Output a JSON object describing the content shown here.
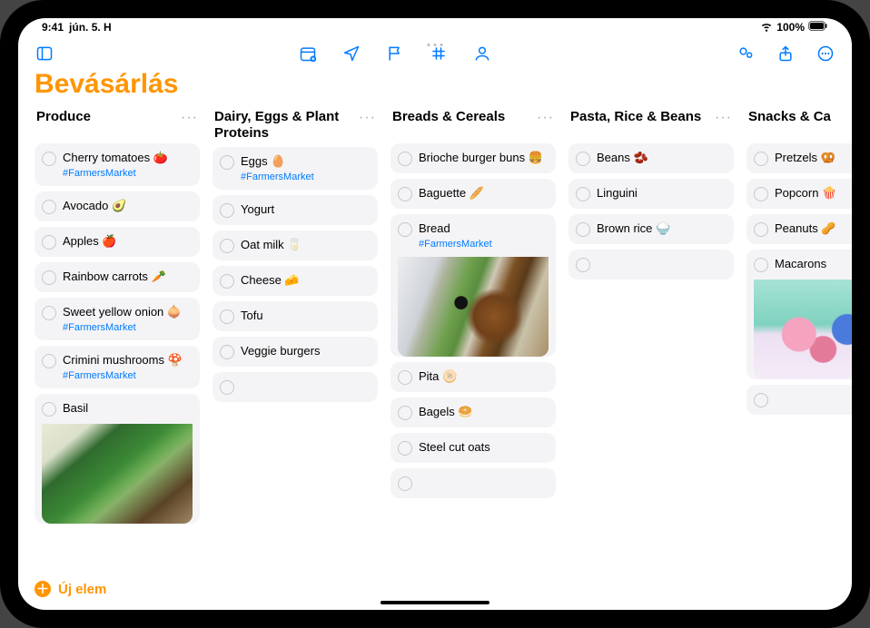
{
  "status": {
    "time": "9:41",
    "date": "jún. 5. H",
    "battery": "100%"
  },
  "list": {
    "title": "Bevásárlás",
    "newItemLabel": "Új elem"
  },
  "columns": [
    {
      "title": "Produce",
      "items": [
        {
          "text": "Cherry tomatoes 🍅",
          "tag": "#FarmersMarket"
        },
        {
          "text": "Avocado 🥑"
        },
        {
          "text": "Apples 🍎"
        },
        {
          "text": "Rainbow carrots 🥕"
        },
        {
          "text": "Sweet yellow onion 🧅",
          "tag": "#FarmersMarket"
        },
        {
          "text": "Crimini mushrooms 🍄",
          "tag": "#FarmersMarket"
        },
        {
          "text": "Basil",
          "image": "basil"
        }
      ]
    },
    {
      "title": "Dairy, Eggs & Plant Proteins",
      "items": [
        {
          "text": "Eggs 🥚",
          "tag": "#FarmersMarket"
        },
        {
          "text": "Yogurt"
        },
        {
          "text": "Oat milk 🥛"
        },
        {
          "text": "Cheese 🧀"
        },
        {
          "text": "Tofu"
        },
        {
          "text": "Veggie burgers"
        },
        {
          "empty": true
        }
      ]
    },
    {
      "title": "Breads & Cereals",
      "items": [
        {
          "text": "Brioche burger buns 🍔"
        },
        {
          "text": "Baguette 🥖"
        },
        {
          "text": "Bread",
          "tag": "#FarmersMarket",
          "image": "bread"
        },
        {
          "text": "Pita 🫓"
        },
        {
          "text": "Bagels 🥯"
        },
        {
          "text": "Steel cut oats"
        },
        {
          "empty": true
        }
      ]
    },
    {
      "title": "Pasta, Rice & Beans",
      "items": [
        {
          "text": "Beans 🫘"
        },
        {
          "text": "Linguini"
        },
        {
          "text": "Brown rice 🍚"
        },
        {
          "empty": true
        }
      ]
    },
    {
      "title": "Snacks & Ca",
      "items": [
        {
          "text": "Pretzels 🥨"
        },
        {
          "text": "Popcorn 🍿"
        },
        {
          "text": "Peanuts 🥜"
        },
        {
          "text": "Macarons",
          "image": "macarons"
        },
        {
          "empty": true
        }
      ]
    }
  ]
}
